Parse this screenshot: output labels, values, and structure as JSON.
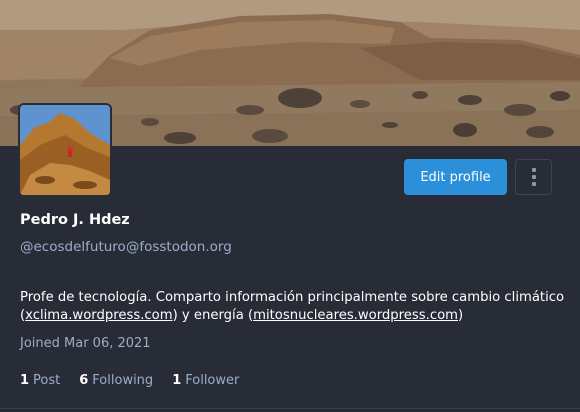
{
  "profile": {
    "display_name": "Pedro J. Hdez",
    "handle": "@ecosdelfuturo@fosstodon.org",
    "bio_part1": "Profe de tecnología. Comparto información principalmente sobre cambio climático (",
    "bio_link1": "xclima.wordpress.com",
    "bio_part2": ") y energía (",
    "bio_link2": "mitosnucleares.wordpress.com",
    "bio_part3": ")",
    "joined": "Joined Mar 06, 2021"
  },
  "actions": {
    "edit_label": "Edit profile",
    "more_icon": "vertical-ellipsis-icon"
  },
  "stats": {
    "posts_count": "1",
    "posts_label": "Post",
    "following_count": "6",
    "following_label": "Following",
    "followers_count": "1",
    "followers_label": "Follower"
  },
  "colors": {
    "background": "#282c37",
    "accent": "#2b90d9",
    "muted": "#9baec8"
  }
}
